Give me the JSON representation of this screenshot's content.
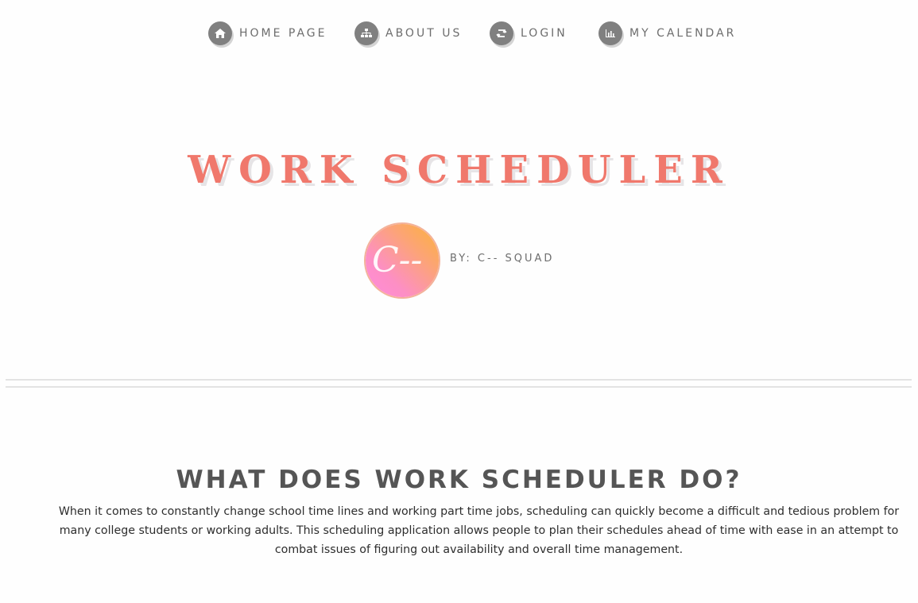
{
  "nav": {
    "items": [
      {
        "label": "HOME PAGE",
        "icon": "home-icon"
      },
      {
        "label": "ABOUT US",
        "icon": "sitemap-icon"
      },
      {
        "label": "LOGIN",
        "icon": "retweet-icon"
      },
      {
        "label": "MY CALENDAR",
        "icon": "bar-chart-icon"
      }
    ]
  },
  "hero": {
    "title": "WORK SCHEDULER",
    "byline": "BY: C-- SQUAD",
    "logo_text": "C--"
  },
  "about": {
    "heading": "WHAT DOES WORK SCHEDULER DO?",
    "body": "When it comes to constantly change school time lines and working part time jobs, scheduling can quickly become a difficult and tedious problem for many college students or working adults. This scheduling application allows people to plan their schedules ahead of time with ease in an attempt to combat issues of figuring out availability and overall time management."
  },
  "colors": {
    "title": "#f0786c",
    "nav_icon_bg": "#808080",
    "nav_text": "#6d6d6d",
    "heading": "#555555"
  }
}
